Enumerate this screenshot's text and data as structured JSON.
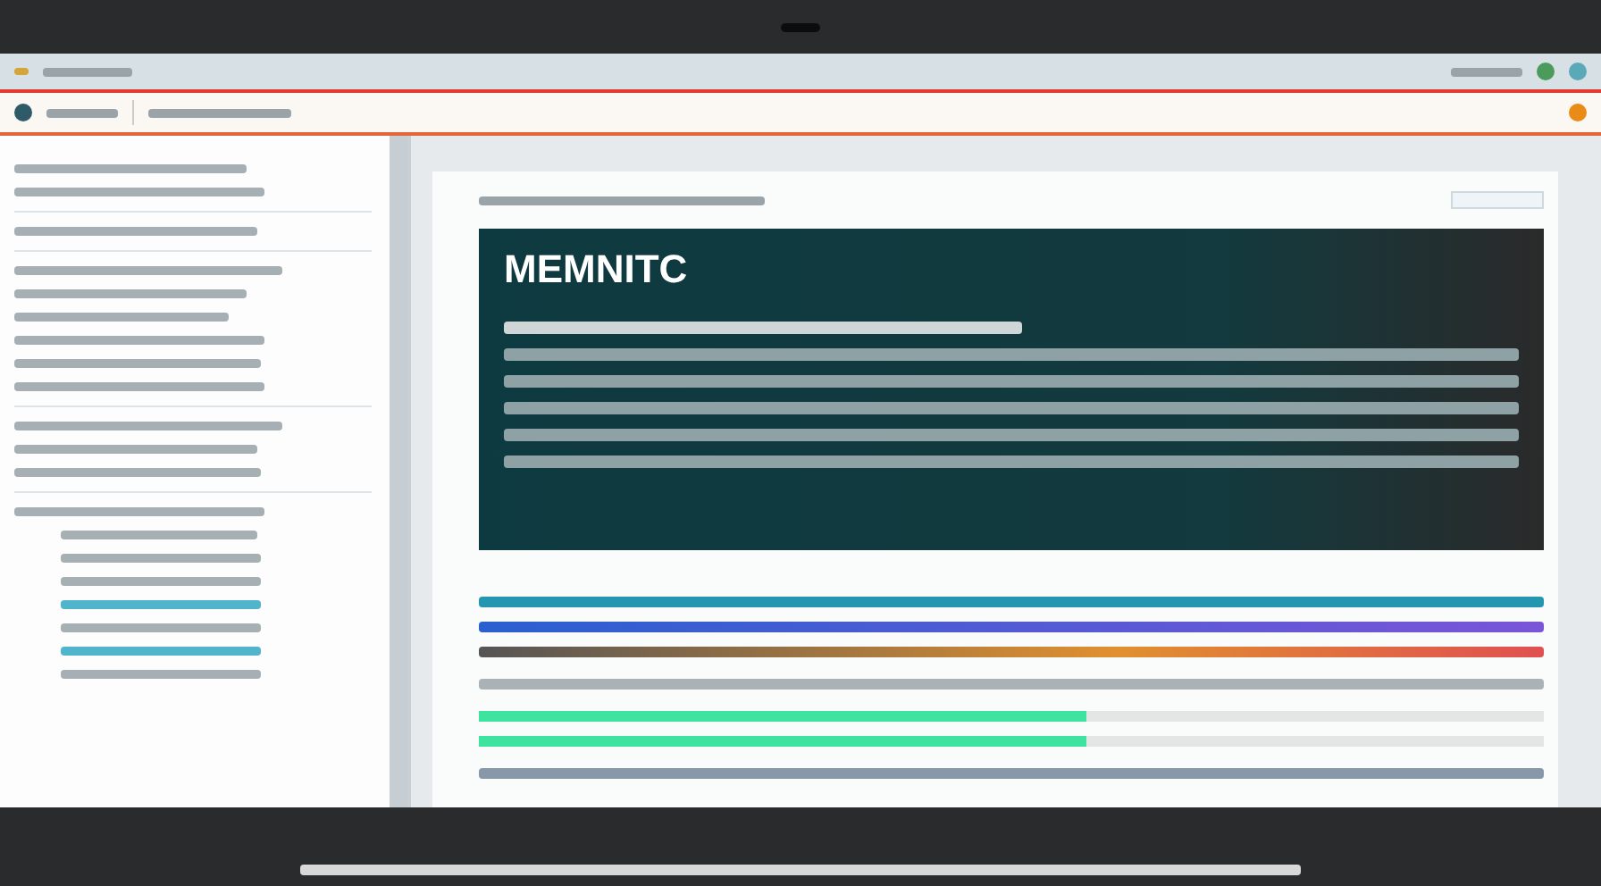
{
  "banner": {
    "title": "MEMNITC"
  },
  "progress": [
    {
      "level": 0.57
    },
    {
      "level": 0.57
    }
  ]
}
